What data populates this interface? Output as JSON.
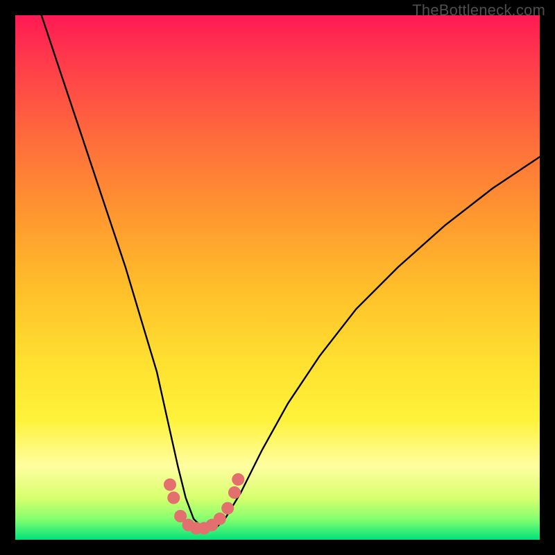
{
  "watermark": "TheBottleneck.com",
  "chart_data": {
    "type": "line",
    "title": "",
    "xlabel": "",
    "ylabel": "",
    "xlim": [
      0,
      100
    ],
    "ylim": [
      0,
      100
    ],
    "series": [
      {
        "name": "bottleneck-curve",
        "x": [
          5,
          9,
          13,
          17,
          21,
          24,
          27,
          29,
          31,
          32.5,
          34,
          36,
          38,
          40,
          43,
          47,
          52,
          58,
          65,
          73,
          82,
          91,
          100
        ],
        "values": [
          100,
          88,
          76,
          64,
          52,
          42,
          32,
          23,
          14,
          8,
          4,
          2,
          2,
          4,
          9,
          17,
          26,
          35,
          44,
          52,
          60,
          67,
          73
        ]
      }
    ],
    "markers": {
      "name": "highlight-dots",
      "color": "#e36f6f",
      "points": [
        {
          "x": 29.5,
          "y": 10.5
        },
        {
          "x": 30.2,
          "y": 8.0
        },
        {
          "x": 31.5,
          "y": 4.5
        },
        {
          "x": 33.0,
          "y": 2.8
        },
        {
          "x": 34.5,
          "y": 2.2
        },
        {
          "x": 36.0,
          "y": 2.2
        },
        {
          "x": 37.5,
          "y": 2.8
        },
        {
          "x": 39.0,
          "y": 4.0
        },
        {
          "x": 40.5,
          "y": 6.0
        },
        {
          "x": 41.8,
          "y": 9.0
        },
        {
          "x": 42.5,
          "y": 11.5
        }
      ]
    }
  }
}
